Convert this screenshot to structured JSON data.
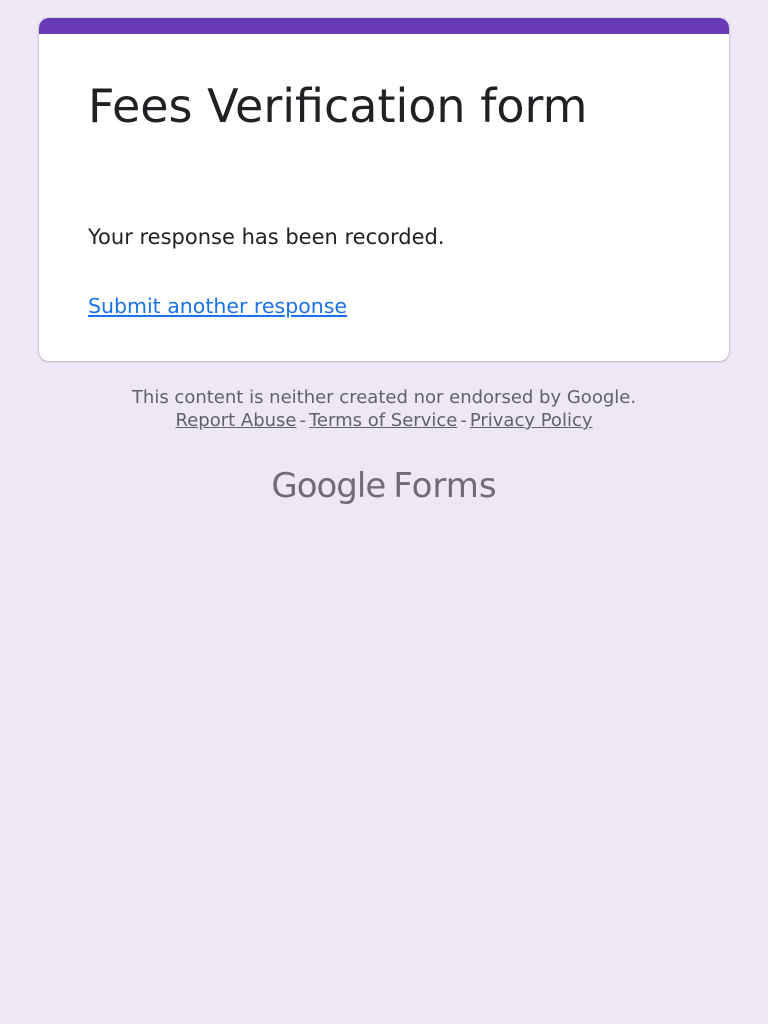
{
  "card": {
    "title": "Fees Verification form",
    "confirmation": "Your response has been recorded.",
    "submit_another_label": "Submit another response"
  },
  "footer": {
    "disclaimer": "This content is neither created nor endorsed by Google.",
    "links": {
      "report_abuse": "Report Abuse",
      "terms": "Terms of Service",
      "privacy": "Privacy Policy"
    },
    "separator": "-"
  },
  "brand": {
    "google": "Google",
    "product": "Forms"
  },
  "colors": {
    "background": "#ede7f6",
    "accent": "#673ab7",
    "link": "#1a73e8",
    "text": "#202124",
    "muted": "#5f6368"
  }
}
